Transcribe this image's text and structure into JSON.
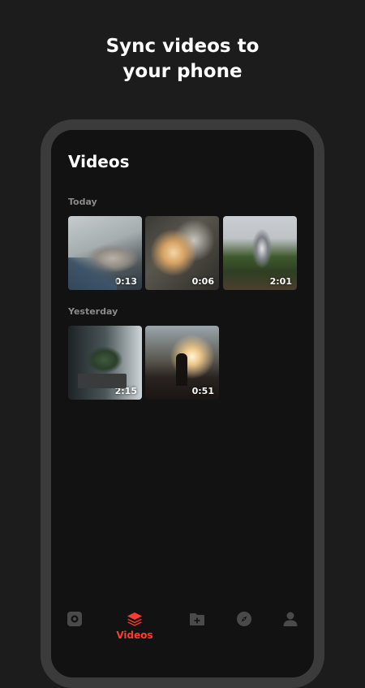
{
  "headline": {
    "line1": "Sync videos to",
    "line2": "your phone"
  },
  "screen": {
    "title": "Videos",
    "sections": [
      {
        "label": "Today",
        "videos": [
          {
            "duration": "0:13"
          },
          {
            "duration": "0:06"
          },
          {
            "duration": "2:01"
          }
        ]
      },
      {
        "label": "Yesterday",
        "videos": [
          {
            "duration": "2:15"
          },
          {
            "duration": "0:51"
          }
        ]
      }
    ]
  },
  "tabbar": {
    "active_color": "#ff3b2f",
    "inactive_color": "#4a4a4a",
    "items": [
      {
        "icon": "record-icon",
        "label": ""
      },
      {
        "icon": "stack-icon",
        "label": "Videos",
        "active": true
      },
      {
        "icon": "folder-add-icon",
        "label": ""
      },
      {
        "icon": "compass-icon",
        "label": ""
      },
      {
        "icon": "profile-icon",
        "label": ""
      }
    ]
  }
}
